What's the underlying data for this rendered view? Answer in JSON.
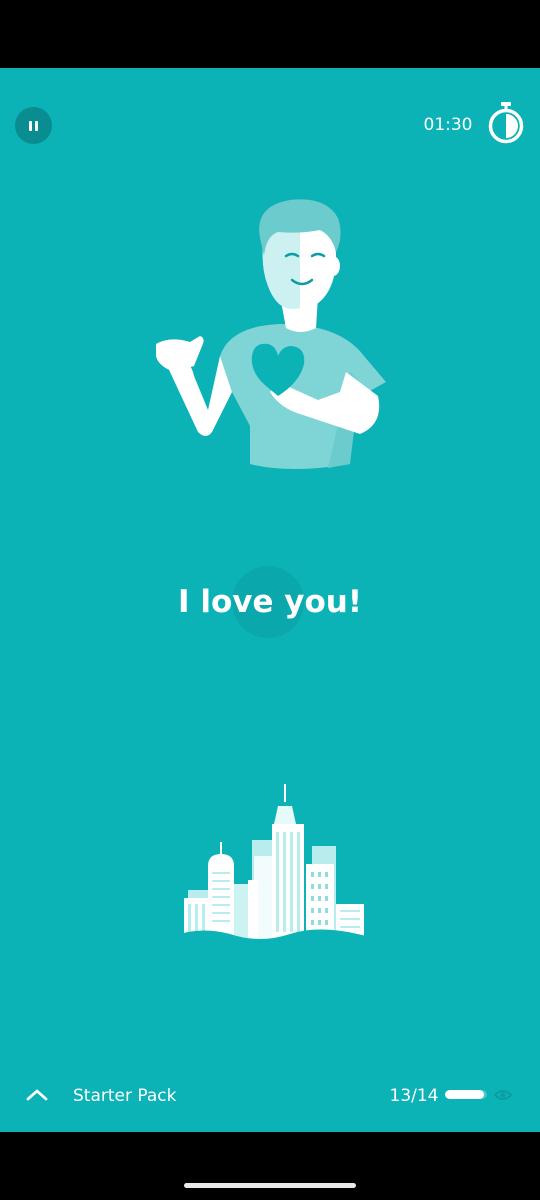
{
  "colors": {
    "background": "#0bb2b6",
    "pause_button_bg": "#0a8d91",
    "text": "#ffffff"
  },
  "header": {
    "pause_icon": "pause-icon",
    "timer": "01:30",
    "timer_icon": "stopwatch-icon"
  },
  "main": {
    "illustration": "man-holding-heart-illustration",
    "phrase": "I love you!",
    "background_illustration": "city-skyline-illustration"
  },
  "footer": {
    "expand_icon": "chevron-up-icon",
    "pack_title": "Starter Pack",
    "progress_text": "13/14",
    "progress_fraction": 0.93,
    "visibility_icon": "eye-icon"
  }
}
